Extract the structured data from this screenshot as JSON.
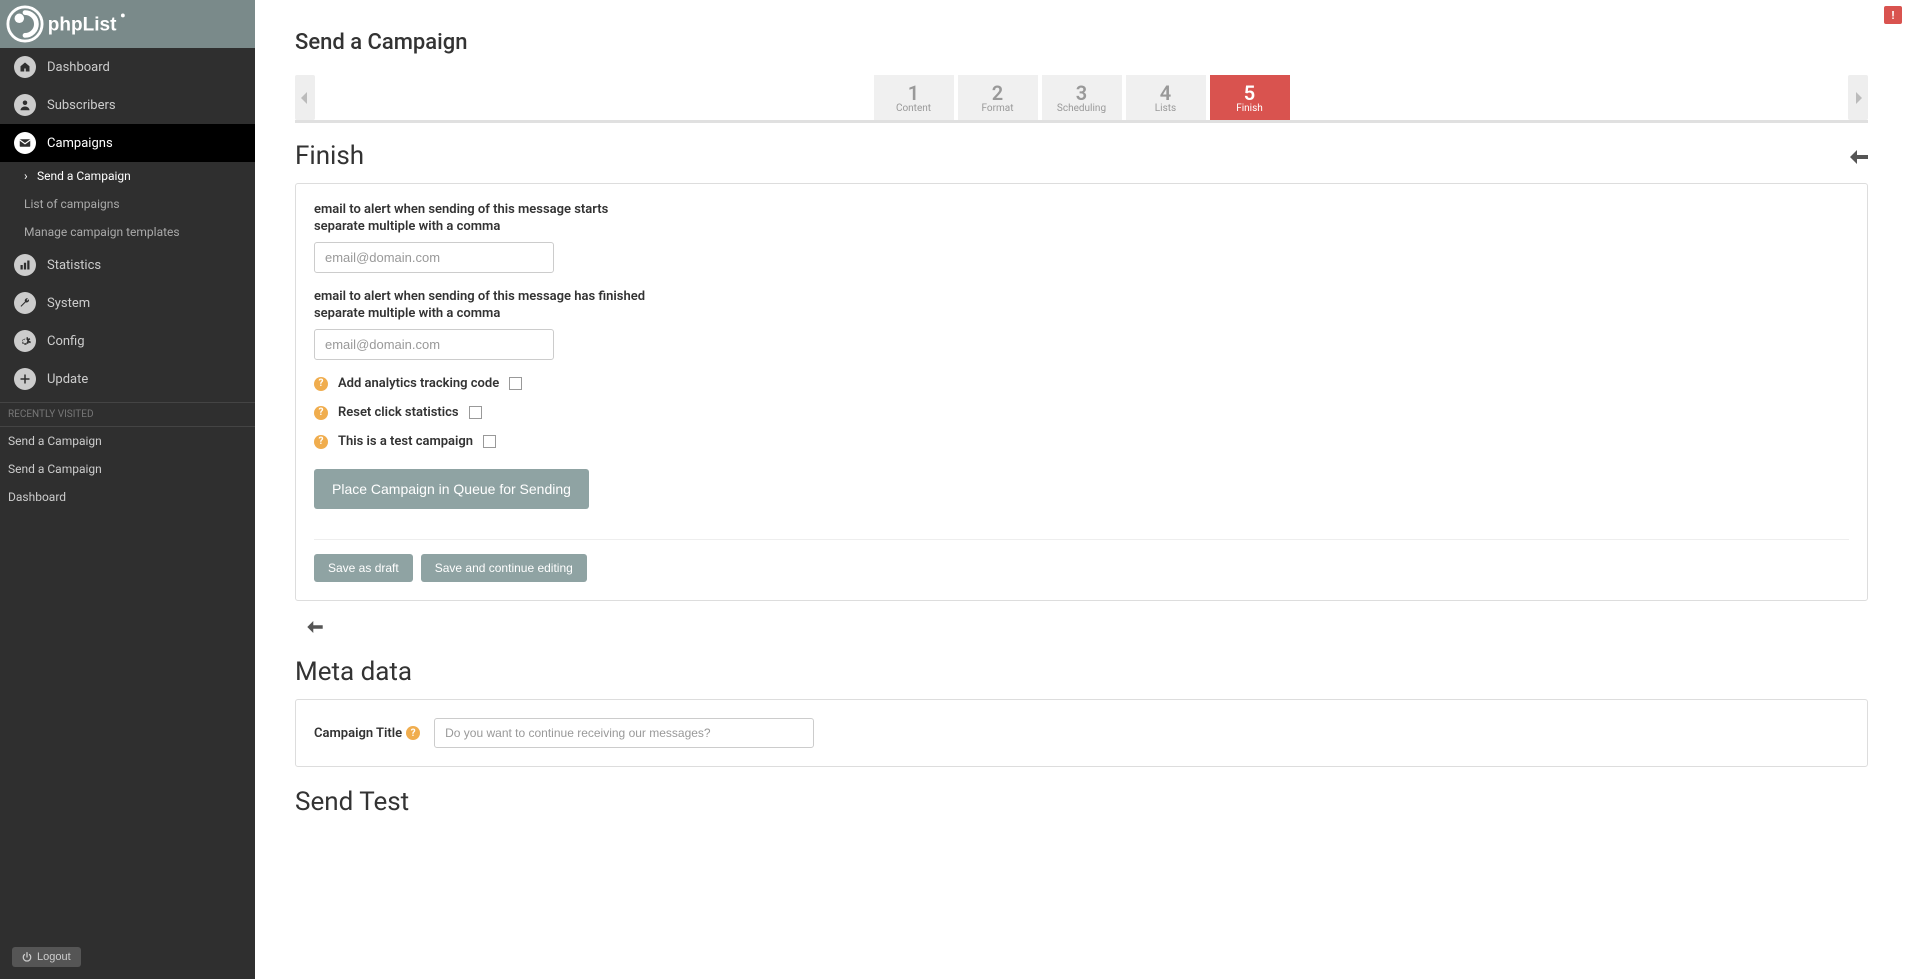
{
  "brand": "phpList",
  "alert_badge": "!",
  "sidebar": {
    "items": [
      {
        "label": "Dashboard",
        "icon": "home"
      },
      {
        "label": "Subscribers",
        "icon": "user"
      },
      {
        "label": "Campaigns",
        "icon": "mail",
        "active": true
      },
      {
        "label": "Statistics",
        "icon": "chart"
      },
      {
        "label": "System",
        "icon": "wrench"
      },
      {
        "label": "Config",
        "icon": "gear"
      },
      {
        "label": "Update",
        "icon": "plus"
      }
    ],
    "sub_items": [
      {
        "label": "Send a Campaign",
        "current": true
      },
      {
        "label": "List of campaigns"
      },
      {
        "label": "Manage campaign templates"
      }
    ],
    "recent_label": "RECENTLY VISITED",
    "recent": [
      "Send a Campaign",
      "Send a Campaign",
      "Dashboard"
    ],
    "logout": "Logout"
  },
  "page": {
    "title": "Send a Campaign",
    "tabs": [
      {
        "num": "1",
        "label": "Content"
      },
      {
        "num": "2",
        "label": "Format"
      },
      {
        "num": "3",
        "label": "Scheduling"
      },
      {
        "num": "4",
        "label": "Lists"
      },
      {
        "num": "5",
        "label": "Finish",
        "active": true
      }
    ],
    "finish": {
      "heading": "Finish",
      "start_label": "email to alert when sending of this message starts",
      "start_sub": "separate multiple with a comma",
      "start_placeholder": "email@domain.com",
      "end_label": "email to alert when sending of this message has finished",
      "end_sub": "separate multiple with a comma",
      "end_placeholder": "email@domain.com",
      "opt_analytics": "Add analytics tracking code",
      "opt_reset": "Reset click statistics",
      "opt_test": "This is a test campaign",
      "queue_btn": "Place Campaign in Queue for Sending",
      "save_draft": "Save as draft",
      "save_continue": "Save and continue editing"
    },
    "meta": {
      "heading": "Meta data",
      "title_label": "Campaign Title",
      "title_placeholder": "Do you want to continue receiving our messages?"
    },
    "sendtest": {
      "heading": "Send Test"
    }
  }
}
